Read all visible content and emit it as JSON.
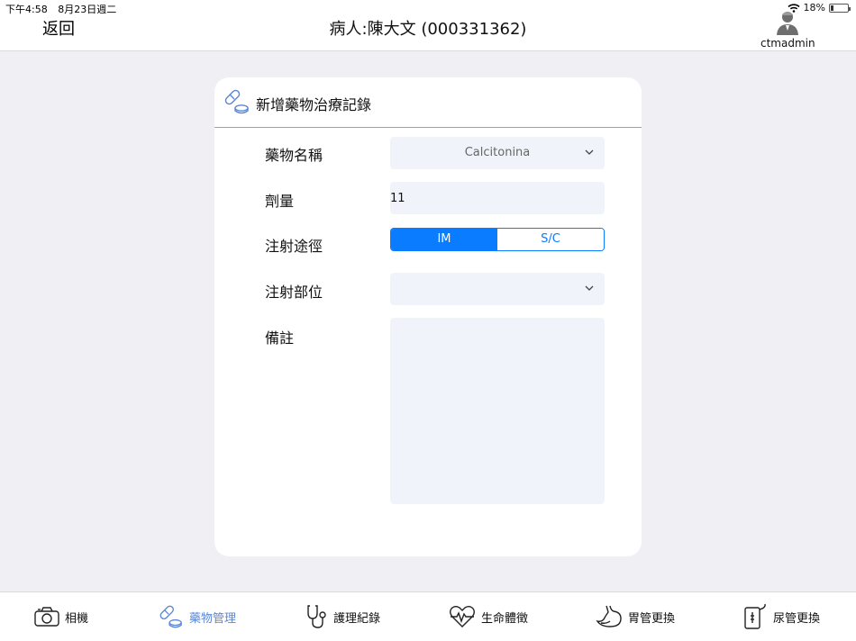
{
  "status_bar": {
    "time": "下午4:58",
    "date": "8月23日週二",
    "battery": "18%"
  },
  "header": {
    "back_label": "返回",
    "title": "病人:陳大文 (000331362)",
    "user": "ctmadmin"
  },
  "card": {
    "title": "新增藥物治療記錄",
    "drug_name": {
      "label": "藥物名稱",
      "value": "Calcitonina"
    },
    "dose": {
      "label": "劑量",
      "value": "11"
    },
    "route": {
      "label": "注射途徑",
      "options": [
        "IM",
        "S/C"
      ],
      "selected": "IM"
    },
    "site": {
      "label": "注射部位",
      "value": ""
    },
    "notes": {
      "label": "備註",
      "value": ""
    }
  },
  "tabbar": {
    "items": [
      {
        "label": "相機",
        "icon": "camera-icon"
      },
      {
        "label": "藥物管理",
        "icon": "pill-icon"
      },
      {
        "label": "護理紀錄",
        "icon": "stethoscope-icon"
      },
      {
        "label": "生命體徵",
        "icon": "heartbeat-icon"
      },
      {
        "label": "胃管更換",
        "icon": "stomach-icon"
      },
      {
        "label": "尿管更換",
        "icon": "urine-bag-icon"
      }
    ],
    "active_color": "#5a86d6"
  },
  "colors": {
    "accent": "#0a7cff",
    "field_bg": "#f0f4fa",
    "background": "#efeff4"
  }
}
